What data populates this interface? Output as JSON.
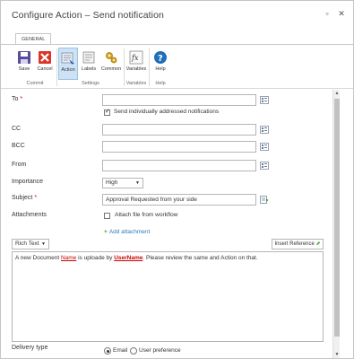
{
  "window": {
    "title": "Configure Action – Send notification",
    "maximize_glyph": "▫",
    "close_glyph": "✕"
  },
  "ribbon": {
    "tab": "GENERAL",
    "groups": {
      "commit": "Commit",
      "settings": "Settings",
      "variables": "Variables",
      "help": "Help"
    },
    "buttons": {
      "save": "Save",
      "cancel": "Cancel",
      "action": "Action",
      "labels": "Labels",
      "common": "Common",
      "variables": "Variables",
      "help": "Help"
    }
  },
  "form": {
    "to_label": "To",
    "required_mark": "*",
    "individual_label": "Send individually addressed notifications",
    "cc_label": "CC",
    "bcc_label": "BCC",
    "from_label": "From",
    "importance_label": "Importance",
    "importance_value": "High",
    "subject_label": "Subject",
    "subject_value": "Approval Requested from your side",
    "attachments_label": "Attachments",
    "attach_workflow_label": "Attach file from workflow",
    "add_attachment": "Add attachment",
    "editor_mode": "Rich Text",
    "insert_reference": "Insert Reference",
    "body": {
      "part1": "A new Document ",
      "token_name": "Name",
      "part2": " is uploade  by ",
      "token_user": "UserName",
      "part3": ". Please review the same and Action on that."
    },
    "delivery_label": "Delivery type",
    "delivery_email": "Email",
    "delivery_user_pref": "User preference"
  },
  "colors": {
    "accent": "#2a7ab8",
    "required": "#cc0000",
    "active_button": "#cde3f5"
  }
}
